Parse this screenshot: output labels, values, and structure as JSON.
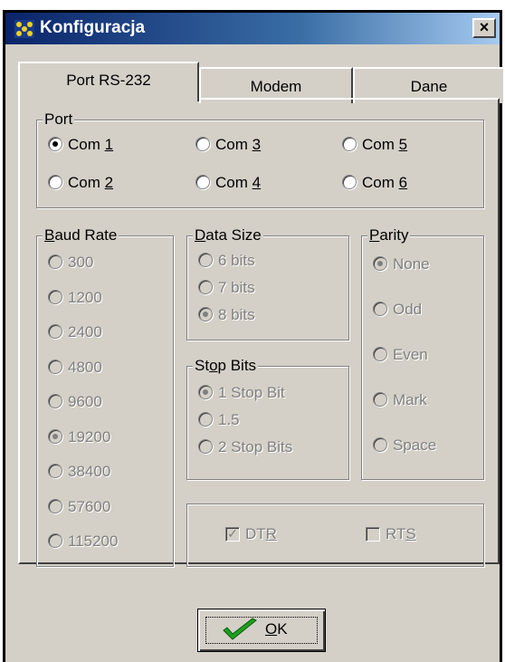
{
  "window": {
    "title": "Konfiguracja",
    "close_glyph": "×"
  },
  "tabs": [
    {
      "label": "Port RS-232",
      "active": true
    },
    {
      "label": "Modem",
      "active": false
    },
    {
      "label": "Dane",
      "active": false
    }
  ],
  "port": {
    "legend": "Port",
    "options": [
      {
        "pre": "Com ",
        "u": "1",
        "selected": true
      },
      {
        "pre": "Com ",
        "u": "3",
        "selected": false
      },
      {
        "pre": "Com ",
        "u": "5",
        "selected": false
      },
      {
        "pre": "Com ",
        "u": "2",
        "selected": false
      },
      {
        "pre": "Com ",
        "u": "4",
        "selected": false
      },
      {
        "pre": "Com ",
        "u": "6",
        "selected": false
      }
    ]
  },
  "baud_rate": {
    "legend_u": "B",
    "legend_rest": "aud Rate",
    "options": [
      "300",
      "1200",
      "2400",
      "4800",
      "9600",
      "19200",
      "38400",
      "57600",
      "115200"
    ],
    "selected": "19200"
  },
  "data_size": {
    "legend_u": "D",
    "legend_rest": "ata Size",
    "options": [
      "6 bits",
      "7 bits",
      "8 bits"
    ],
    "selected": "8 bits"
  },
  "stop_bits": {
    "legend_pre": "St",
    "legend_u": "o",
    "legend_rest": "p Bits",
    "options": [
      "1 Stop Bit",
      "1.5",
      "2 Stop Bits"
    ],
    "selected": "1 Stop Bit"
  },
  "parity": {
    "legend_u": "P",
    "legend_rest": "arity",
    "options": [
      "None",
      "Odd",
      "Even",
      "Mark",
      "Space"
    ],
    "selected": "None"
  },
  "dtr": {
    "pre": "DT",
    "u": "R",
    "checked": true,
    "check_glyph": "✓"
  },
  "rts": {
    "pre": "RT",
    "u": "S",
    "checked": false
  },
  "ok_button": {
    "u": "O",
    "rest": "K"
  },
  "colors": {
    "accent_check": "#1f9f1f",
    "titlebar": "#0a246a"
  }
}
